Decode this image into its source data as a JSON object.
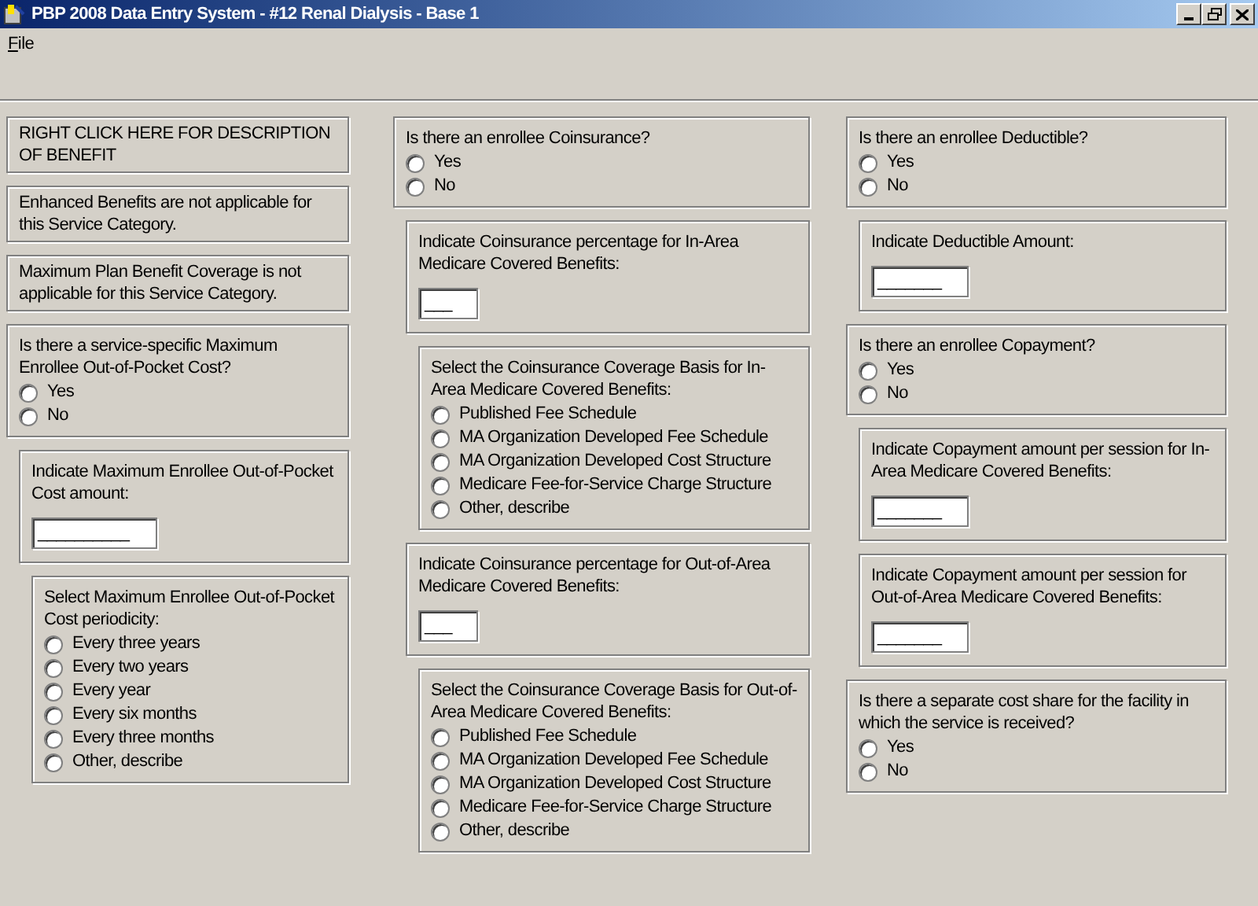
{
  "window": {
    "title": "PBP 2008 Data Entry System - #12 Renal Dialysis - Base 1"
  },
  "menu": [
    {
      "label": "File"
    }
  ],
  "columns": [
    {
      "boxes": [
        {
          "kind": "note",
          "text": "RIGHT CLICK HERE FOR DESCRIPTION OF BENEFIT"
        },
        {
          "kind": "note",
          "text": "Enhanced Benefits are not applicable for this Service Category."
        },
        {
          "kind": "note",
          "text": "Maximum Plan Benefit Coverage is not applicable for this Service Category."
        },
        {
          "kind": "question",
          "text": "Is there a service-specific Maximum Enrollee Out-of-Pocket Cost?",
          "options": [
            {
              "label": "Yes",
              "selected": false
            },
            {
              "label": "No",
              "selected": false
            }
          ]
        },
        {
          "kind": "field",
          "text": "Indicate Maximum Enrollee Out-of-Pocket Cost amount:",
          "value": "__________"
        },
        {
          "kind": "choice",
          "text": "Select Maximum Enrollee Out-of-Pocket Cost periodicity:",
          "options": [
            {
              "label": "Every three years",
              "selected": false
            },
            {
              "label": "Every two years",
              "selected": false
            },
            {
              "label": "Every year",
              "selected": false
            },
            {
              "label": "Every six months",
              "selected": false
            },
            {
              "label": "Every three months",
              "selected": false
            },
            {
              "label": "Other, describe",
              "selected": false
            }
          ]
        }
      ]
    },
    {
      "boxes": [
        {
          "kind": "question",
          "text": "Is there an enrollee Coinsurance?",
          "options": [
            {
              "label": "Yes",
              "selected": false
            },
            {
              "label": "No",
              "selected": false
            }
          ]
        },
        {
          "kind": "field",
          "text": "Indicate Coinsurance percentage for In-Area Medicare Covered Benefits:",
          "value": "___"
        },
        {
          "kind": "choice",
          "text": "Select the Coinsurance Coverage Basis for In-Area Medicare Covered Benefits:",
          "options": [
            {
              "label": "Published Fee Schedule",
              "selected": false
            },
            {
              "label": "MA Organization Developed Fee Schedule",
              "selected": false
            },
            {
              "label": "MA Organization Developed Cost Structure",
              "selected": false
            },
            {
              "label": "Medicare Fee-for-Service Charge Structure",
              "selected": false
            },
            {
              "label": "Other, describe",
              "selected": false
            }
          ]
        },
        {
          "kind": "field",
          "text": "Indicate Coinsurance percentage for Out-of-Area Medicare Covered Benefits:",
          "value": "___"
        },
        {
          "kind": "choice",
          "text": "Select the Coinsurance Coverage Basis for Out-of-Area Medicare Covered Benefits:",
          "options": [
            {
              "label": "Published Fee Schedule",
              "selected": false
            },
            {
              "label": "MA Organization Developed Fee Schedule",
              "selected": false
            },
            {
              "label": "MA Organization Developed Cost Structure",
              "selected": false
            },
            {
              "label": "Medicare Fee-for-Service Charge Structure",
              "selected": false
            },
            {
              "label": "Other, describe",
              "selected": false
            }
          ]
        }
      ]
    },
    {
      "boxes": [
        {
          "kind": "question",
          "text": "Is there an enrollee Deductible?",
          "options": [
            {
              "label": "Yes",
              "selected": false
            },
            {
              "label": "No",
              "selected": false
            }
          ]
        },
        {
          "kind": "field",
          "text": "Indicate Deductible Amount:",
          "value": "_______"
        },
        {
          "kind": "question",
          "text": "Is there an enrollee Copayment?",
          "options": [
            {
              "label": "Yes",
              "selected": false
            },
            {
              "label": "No",
              "selected": false
            }
          ]
        },
        {
          "kind": "field",
          "text": "Indicate Copayment amount per session for In-Area Medicare Covered Benefits:",
          "value": "_______"
        },
        {
          "kind": "field",
          "text": "Indicate Copayment amount per session for Out-of-Area Medicare Covered Benefits:",
          "value": "_______"
        },
        {
          "kind": "question",
          "text": "Is there a separate cost share for the facility in which the service is received?",
          "options": [
            {
              "label": "Yes",
              "selected": false
            },
            {
              "label": "No",
              "selected": false
            }
          ]
        }
      ]
    }
  ]
}
